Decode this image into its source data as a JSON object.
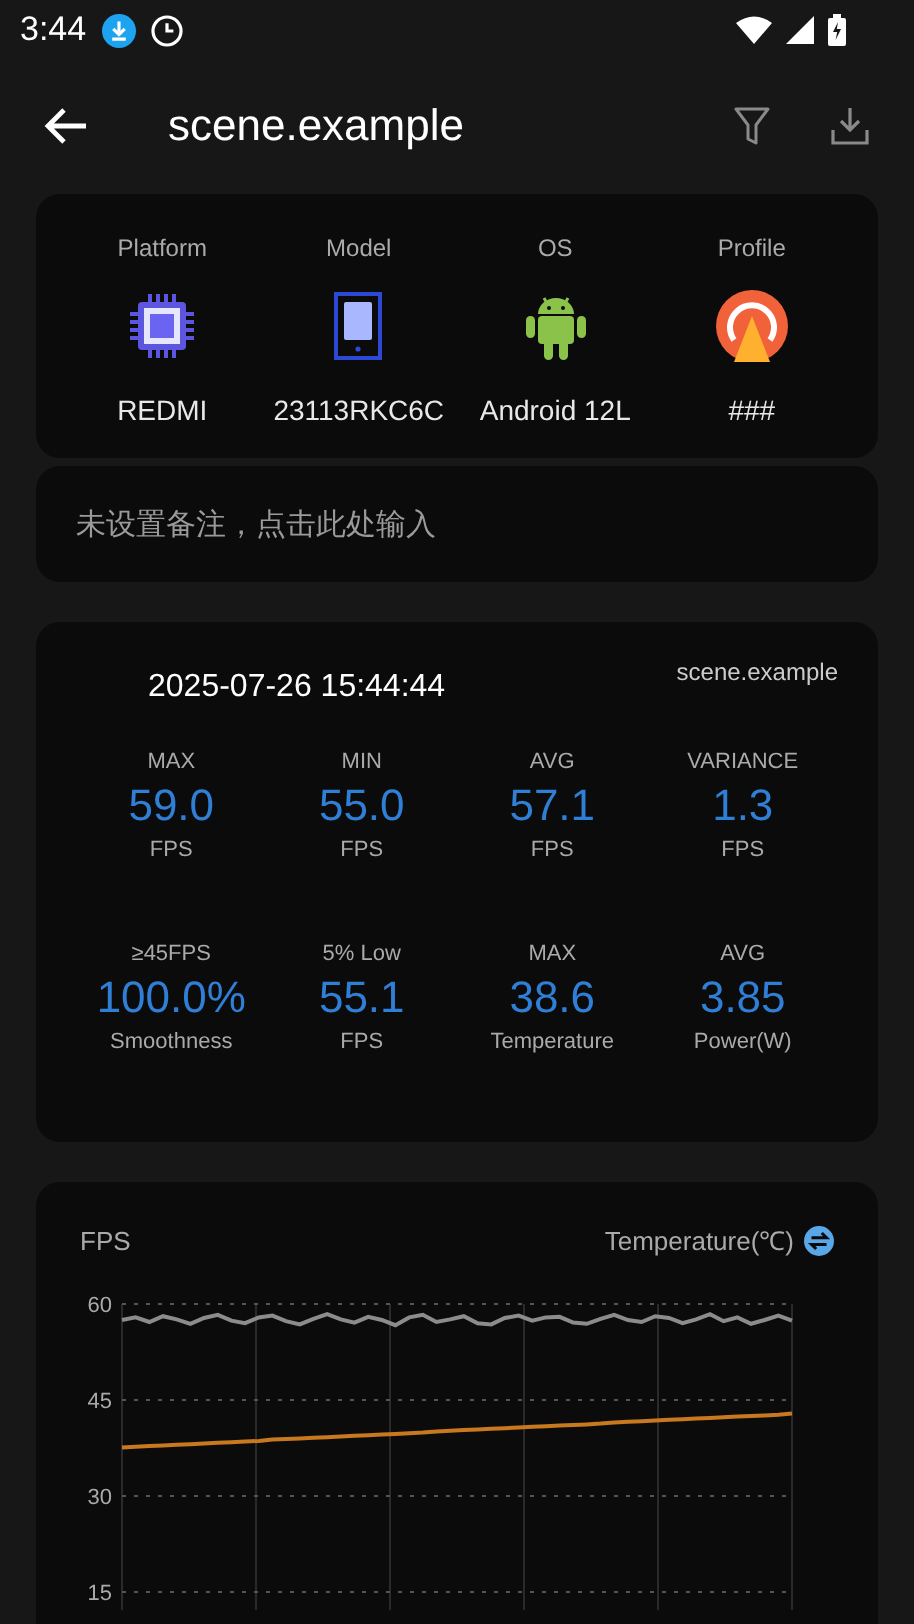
{
  "status_bar": {
    "time": "3:44"
  },
  "app_bar": {
    "title": "scene.example"
  },
  "device": [
    {
      "label": "Platform",
      "value": "REDMI",
      "kind": "chip"
    },
    {
      "label": "Model",
      "value": "23113RKC6C",
      "kind": "phone"
    },
    {
      "label": "OS",
      "value": "Android 12L",
      "kind": "android"
    },
    {
      "label": "Profile",
      "value": "###",
      "kind": "gauge"
    }
  ],
  "note": {
    "placeholder": "未设置备注，点击此处输入"
  },
  "summary": {
    "datetime": "2025-07-26 15:44:44",
    "app": "scene.example",
    "stats": [
      {
        "label": "MAX",
        "value": "59.0",
        "unit": "FPS"
      },
      {
        "label": "MIN",
        "value": "55.0",
        "unit": "FPS"
      },
      {
        "label": "AVG",
        "value": "57.1",
        "unit": "FPS"
      },
      {
        "label": "VARIANCE",
        "value": "1.3",
        "unit": "FPS"
      },
      {
        "label": "≥45FPS",
        "value": "100.0%",
        "unit": "Smoothness"
      },
      {
        "label": "5% Low",
        "value": "55.1",
        "unit": "FPS"
      },
      {
        "label": "MAX",
        "value": "38.6",
        "unit": "Temperature"
      },
      {
        "label": "AVG",
        "value": "3.85",
        "unit": "Power(W)"
      }
    ]
  },
  "chart": {
    "chart_data": {
      "type": "line",
      "grid": true,
      "ylim": [
        15,
        60
      ],
      "yticks": [
        60,
        45,
        30,
        15
      ],
      "series": [
        {
          "name": "FPS",
          "color": "#8c8c8c",
          "values": [
            57.5,
            57.9,
            57.2,
            58.1,
            57.6,
            56.9,
            57.8,
            58.3,
            57.4,
            57.0,
            57.9,
            58.2,
            57.3,
            56.8,
            57.7,
            58.4,
            57.6,
            57.1,
            58.0,
            57.5,
            56.7,
            57.9,
            58.3,
            57.2,
            57.6,
            58.1,
            57.0,
            56.8,
            57.8,
            58.2,
            57.4,
            57.9,
            58.0,
            57.1,
            56.9,
            57.7,
            58.3,
            57.5,
            57.2,
            58.1,
            57.8,
            57.0,
            57.6,
            58.4,
            57.3,
            57.9,
            56.9,
            57.5,
            58.2,
            57.4
          ]
        },
        {
          "name": "Temperature(℃)",
          "color": "#c8781e",
          "values": [
            37.6,
            37.7,
            37.8,
            37.9,
            38.0,
            38.1,
            38.2,
            38.3,
            38.4,
            38.5,
            38.6,
            38.8,
            38.9,
            39.0,
            39.1,
            39.2,
            39.3,
            39.4,
            39.5,
            39.6,
            39.7,
            39.8,
            39.9,
            40.1,
            40.2,
            40.3,
            40.4,
            40.5,
            40.6,
            40.7,
            40.8,
            40.9,
            41.0,
            41.1,
            41.2,
            41.3,
            41.5,
            41.6,
            41.7,
            41.8,
            41.9,
            42.0,
            42.1,
            42.2,
            42.3,
            42.4,
            42.5,
            42.6,
            42.7,
            42.9
          ]
        }
      ]
    }
  }
}
